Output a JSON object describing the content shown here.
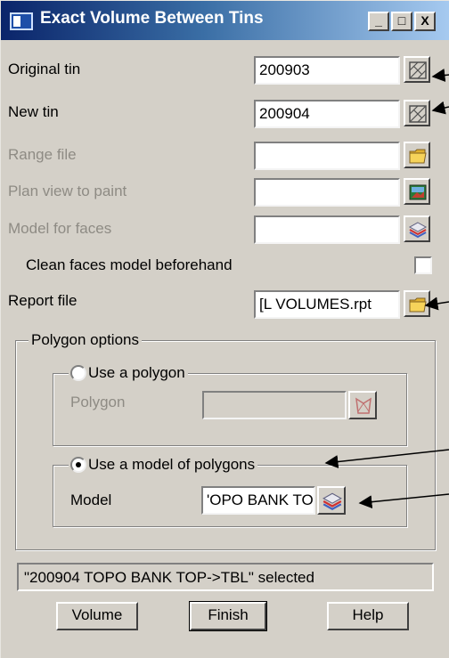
{
  "window": {
    "title": "Exact Volume Between Tins",
    "controls": {
      "minimize": "_",
      "maximize": "□",
      "close": "X"
    }
  },
  "fields": {
    "original_tin": {
      "label": "Original tin",
      "value": "200903",
      "icon": "tin-select-icon"
    },
    "new_tin": {
      "label": "New tin",
      "value": "200904",
      "icon": "tin-select-icon"
    },
    "range_file": {
      "label": "Range file",
      "value": "",
      "icon": "folder-icon"
    },
    "plan_view": {
      "label": "Plan view to paint",
      "value": "",
      "icon": "plan-view-icon"
    },
    "model_faces": {
      "label": "Model for faces",
      "value": "",
      "icon": "model-layers-icon"
    },
    "clean_faces": {
      "label": "Clean faces model beforehand",
      "checked": false
    },
    "report_file": {
      "label": "Report file",
      "value": "[L VOLUMES.rpt",
      "icon": "folder-icon"
    }
  },
  "polygon_options": {
    "legend": "Polygon options",
    "use_polygon": {
      "label": "Use a polygon",
      "selected": false
    },
    "polygon": {
      "label": "Polygon",
      "value": "",
      "icon": "polygon-pick-icon"
    },
    "use_model": {
      "label": "Use a model of polygons",
      "selected": true
    },
    "model": {
      "label": "Model",
      "value": "'OPO BANK TOP",
      "icon": "model-layers-icon"
    }
  },
  "status": {
    "text": "\"200904 TOPO BANK TOP->TBL\" selected"
  },
  "buttons": {
    "volume": "Volume",
    "finish": "Finish",
    "help": "Help"
  },
  "colors": {
    "dialog_bg": "#d4d0c8",
    "title_start": "#0a246a",
    "title_end": "#a6caf0",
    "disabled_text": "#8e8b84"
  }
}
